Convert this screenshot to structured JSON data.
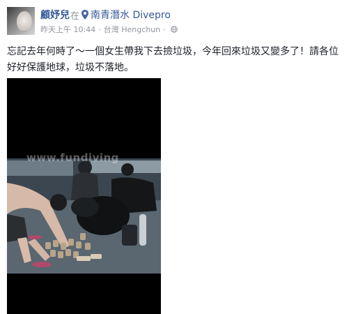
{
  "post": {
    "author": "顧妤兒",
    "at_text": "在",
    "location": "南青潛水 Divepro",
    "timestamp": "昨天上午 10:44",
    "place": "台灣 Hengchun",
    "privacy_icon": "globe-icon",
    "pin_icon": "map-pin-icon",
    "text": "忘記去年何時了～一個女生帶我下去撿垃圾，今年回來垃圾又變多了！請各位好好保護地球，垃圾不落地。",
    "photo": {
      "watermark": "www.fundiving"
    }
  },
  "colors": {
    "link": "#365899",
    "meta": "#90949c",
    "text": "#1d2129"
  }
}
